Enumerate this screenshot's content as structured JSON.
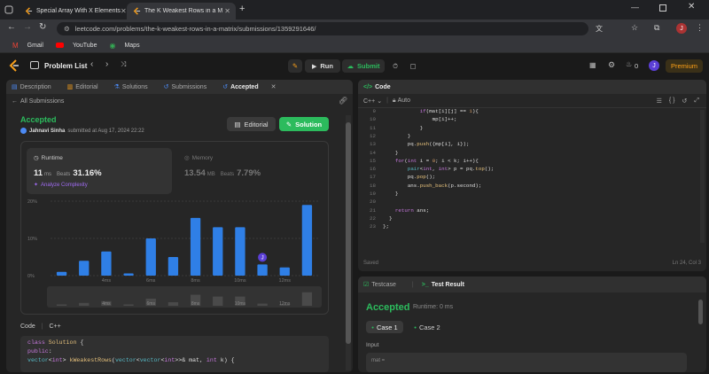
{
  "browser": {
    "tabs": [
      {
        "title": "Special Array With X Elements"
      },
      {
        "title": "The K Weakest Rows in a Matrix"
      }
    ],
    "url": "leetcode.com/problems/the-k-weakest-rows-in-a-matrix/submissions/1359291646/",
    "bookmarks": [
      "Gmail",
      "YouTube",
      "Maps"
    ]
  },
  "nav": {
    "problem_list": "Problem List",
    "run": "Run",
    "submit": "Submit",
    "streak": "0",
    "premium": "Premium",
    "avatar": "J"
  },
  "left": {
    "tabs": [
      "Description",
      "Editorial",
      "Solutions",
      "Submissions",
      "Accepted"
    ],
    "all_submissions": "All Submissions",
    "status": "Accepted",
    "author": "Jahnavi Sinha",
    "submitted": "submitted at Aug 17, 2024 22:22",
    "editorial_btn": "Editorial",
    "solution_btn": "Solution",
    "runtime_label": "Runtime",
    "runtime_value": "11",
    "runtime_unit": "ms",
    "beats_label": "Beats",
    "runtime_beats": "31.16%",
    "analyze": "Analyze Complexity",
    "memory_label": "Memory",
    "memory_value": "13.54",
    "memory_unit": "MB",
    "memory_beats": "7.79%",
    "code_label": "Code",
    "lang": "C++",
    "code_lines": [
      "class Solution {",
      "public:",
      "    vector<int> kWeakestRows(vector<vector<int>>& mat, int k) {",
      "        ..."
    ]
  },
  "chart_data": {
    "type": "bar",
    "ylabels": [
      "20%",
      "10%",
      "0%"
    ],
    "ylim": [
      0,
      20
    ],
    "xlabels": [
      "4ms",
      "6ms",
      "8ms",
      "10ms",
      "12ms"
    ],
    "values": [
      1,
      4,
      6.5,
      0.6,
      10,
      5,
      15.5,
      13,
      13,
      3,
      2.2,
      19
    ],
    "highlight_index": 9,
    "highlight_label": "J",
    "bar_color": "#2f7fe6"
  },
  "editor": {
    "title": "Code",
    "lang": "C++",
    "mode": "Auto",
    "first_line": 9,
    "lines": [
      "            if(mat[i][j] == 1){",
      "                mp[i]++;",
      "            }",
      "        }",
      "        pq.push({mp[i], i});",
      "    }",
      "    for(int i = 0; i < k; i++){",
      "        pair<int, int> p = pq.top();",
      "        pq.pop();",
      "        ans.push_back(p.second);",
      "    }",
      "",
      "    return ans;",
      "  }",
      "};"
    ],
    "saved": "Saved",
    "pos": "Ln 24, Col 3"
  },
  "result": {
    "testcase_tab": "Testcase",
    "result_tab": "Test Result",
    "status": "Accepted",
    "runtime": "Runtime: 0 ms",
    "cases": [
      "Case 1",
      "Case 2"
    ],
    "input_label": "Input",
    "mat_label": "mat ="
  }
}
